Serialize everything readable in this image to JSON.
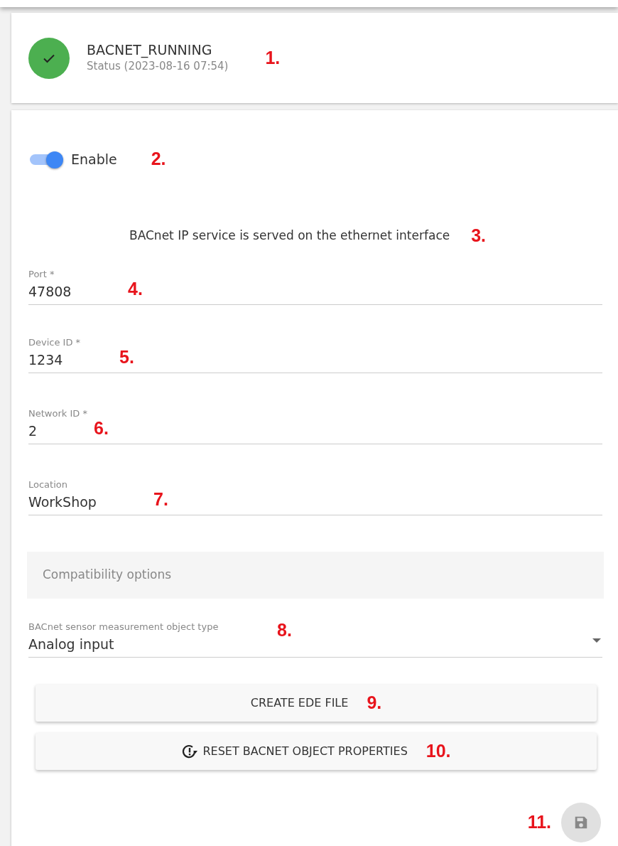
{
  "status_card": {
    "title": "BACNET_RUNNING",
    "subtitle": "Status (2023-08-16 07:54)",
    "marker": "1."
  },
  "enable": {
    "label": "Enable",
    "on": true,
    "marker": "2."
  },
  "info": {
    "text": "BACnet IP service is served on the ethernet interface",
    "marker": "3."
  },
  "fields": [
    {
      "kind": "text",
      "label": "Port *",
      "value": "47808",
      "marker": "4."
    },
    {
      "kind": "text",
      "label": "Device ID *",
      "value": "1234",
      "marker": "5."
    },
    {
      "kind": "text",
      "label": "Network ID *",
      "value": "2",
      "marker": "6."
    },
    {
      "kind": "text",
      "label": "Location",
      "value": "WorkShop",
      "marker": "7."
    }
  ],
  "compatibility_panel": {
    "title": "Compatibility options",
    "expanded": false
  },
  "select": {
    "label": "BACnet sensor measurement object type",
    "value": "Analog input",
    "marker": "8."
  },
  "buttons": [
    {
      "kind": "plain",
      "label": "CREATE EDE FILE",
      "marker": "9."
    },
    {
      "kind": "reset",
      "label": "RESET BACNET OBJECT PROPERTIES",
      "marker": "10."
    }
  ],
  "save": {
    "disabled": true,
    "marker": "11."
  }
}
